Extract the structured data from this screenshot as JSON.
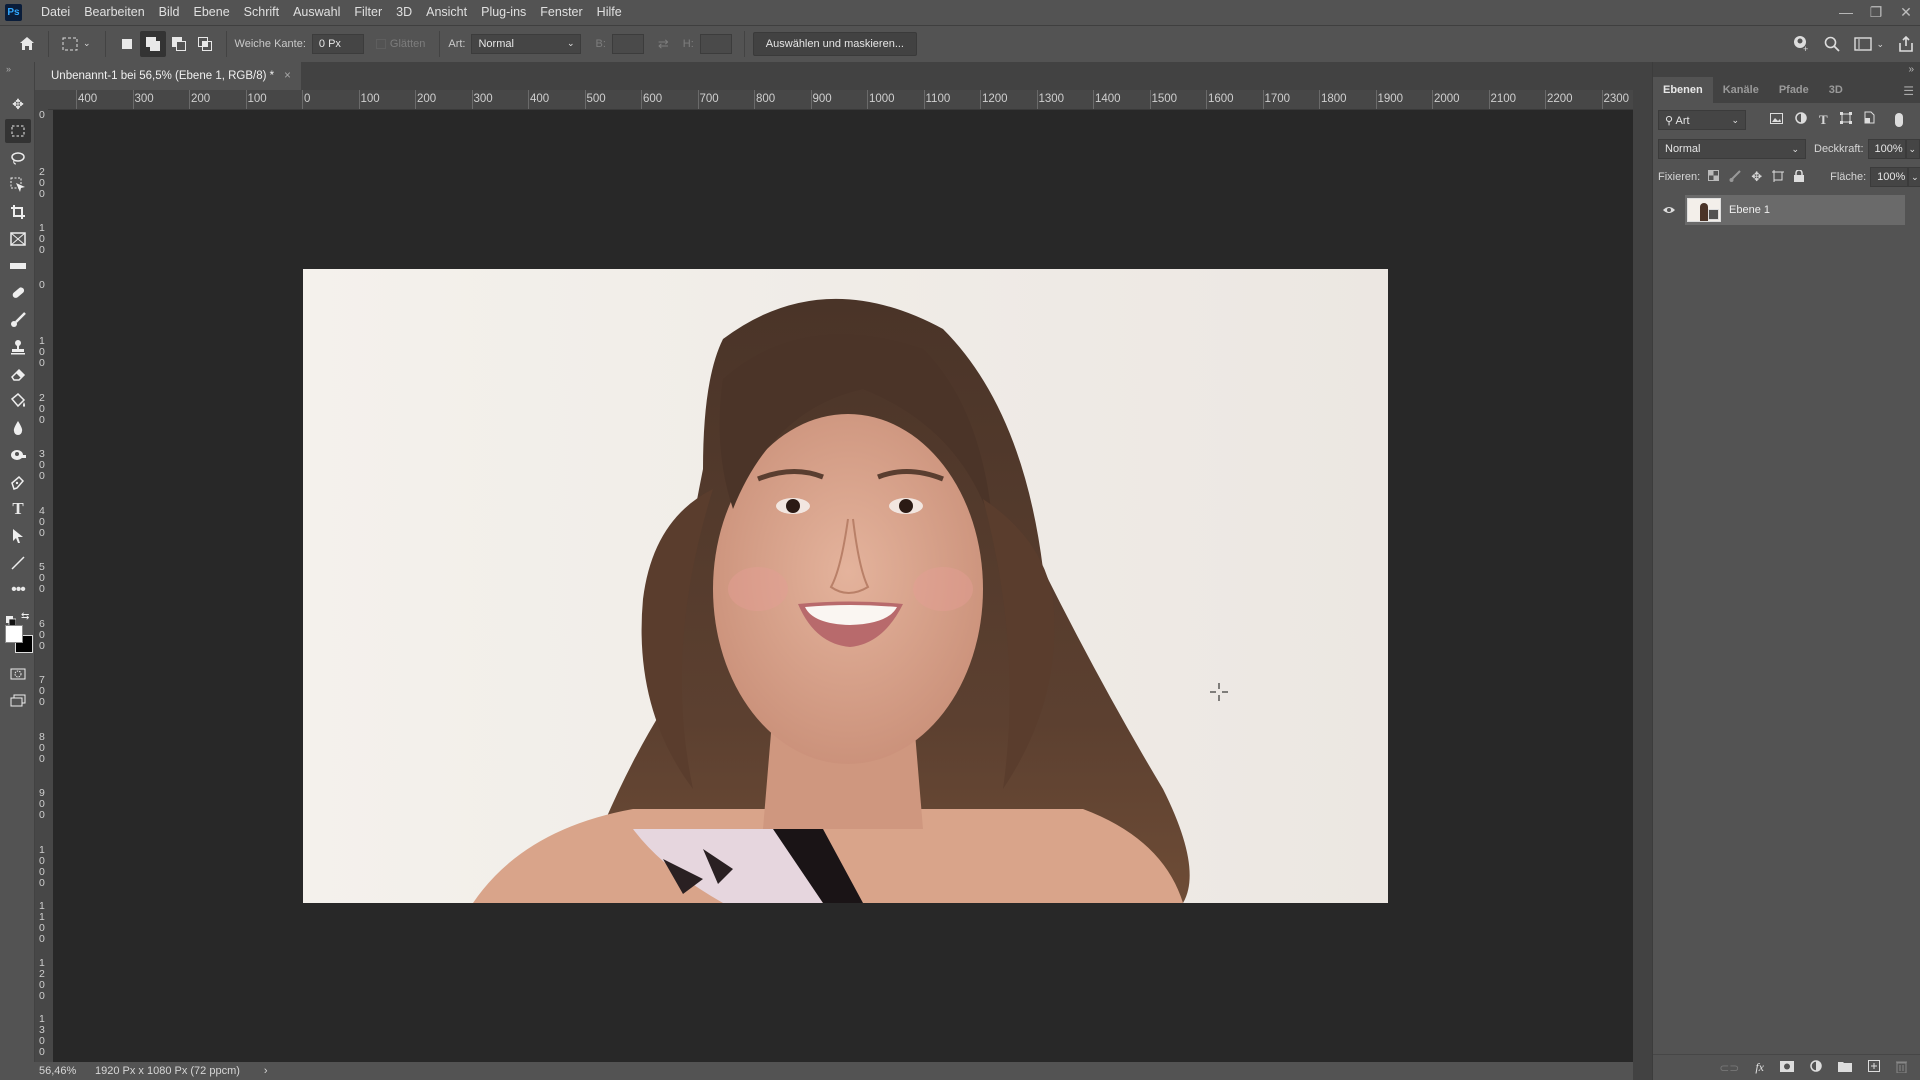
{
  "app": {
    "logo": "Ps"
  },
  "menu": [
    "Datei",
    "Bearbeiten",
    "Bild",
    "Ebene",
    "Schrift",
    "Auswahl",
    "Filter",
    "3D",
    "Ansicht",
    "Plug-ins",
    "Fenster",
    "Hilfe"
  ],
  "window_controls": {
    "minimize": "—",
    "restore": "❐",
    "close": "✕"
  },
  "options": {
    "feather_label": "Weiche Kante:",
    "feather_value": "0 Px",
    "antialias_label": "Glätten",
    "style_label": "Art:",
    "style_value": "Normal",
    "width_label": "B:",
    "height_label": "H:",
    "select_mask_button": "Auswählen und maskieren..."
  },
  "document": {
    "tab_title": "Unbenannt-1 bei 56,5% (Ebene 1, RGB/8) *",
    "close": "×"
  },
  "rulers": {
    "horizontal": [
      "400",
      "300",
      "200",
      "100",
      "0",
      "100",
      "200",
      "300",
      "400",
      "500",
      "600",
      "700",
      "800",
      "900",
      "1000",
      "1100",
      "1200",
      "1300",
      "1400",
      "1500",
      "1600",
      "1700",
      "1800",
      "1900",
      "2000",
      "2100",
      "2200",
      "2300"
    ],
    "vertical": [
      "0",
      "200",
      "100",
      "0",
      "100",
      "200",
      "300",
      "400",
      "500",
      "600",
      "700",
      "800",
      "900",
      "1000",
      "1100",
      "1200",
      "1300"
    ]
  },
  "status": {
    "zoom": "56,46%",
    "doc_info": "1920 Px x 1080 Px (72 ppcm)",
    "arrow": "›"
  },
  "panel": {
    "collapse": "»",
    "tabs": [
      "Ebenen",
      "Kanäle",
      "Pfade",
      "3D"
    ],
    "filter_value": "Art",
    "blend_mode": "Normal",
    "opacity_label": "Deckkraft:",
    "opacity_value": "100%",
    "lock_label": "Fixieren:",
    "fill_label": "Fläche:",
    "fill_value": "100%",
    "layers": [
      {
        "name": "Ebene 1",
        "visible": true
      }
    ]
  },
  "colors": {
    "accent": "#31a8ff",
    "canvas_bg": "#282828",
    "panel_bg": "#535353"
  }
}
